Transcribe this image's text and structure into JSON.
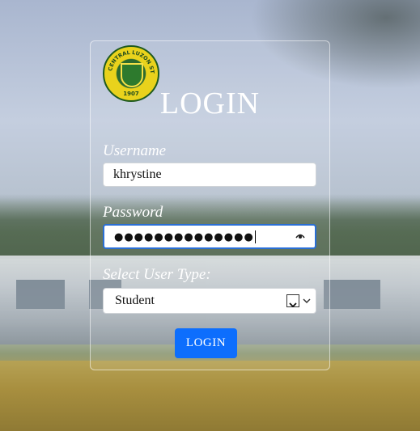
{
  "logo": {
    "ring_text": "CENTRAL LUZON STATE UNIVERSITY",
    "year": "1907"
  },
  "form": {
    "title": "LOGIN",
    "username_label": "Username",
    "username_value": "khrystine",
    "password_label": "Password",
    "password_masked": "●●●●●●●●●●●●●●",
    "usertype_label": "Select User Type:",
    "usertype_selected": "Student",
    "submit_label": "LOGIN"
  },
  "icons": {
    "password_toggle": "eye-icon",
    "dropdown": "chevron-down-icon"
  },
  "colors": {
    "button": "#0d6efd",
    "focus_border": "#2a6fd6",
    "label_text": "#ffffff"
  }
}
